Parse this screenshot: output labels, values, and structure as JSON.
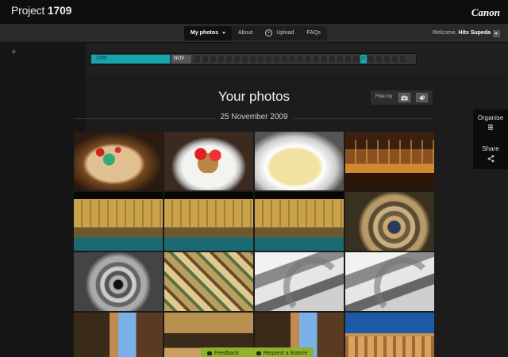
{
  "app": {
    "title_prefix": "Project",
    "title_number": "1709",
    "brand": "Canon"
  },
  "nav": {
    "items": [
      {
        "label": "My photos",
        "active": true
      },
      {
        "label": "About"
      },
      {
        "label": "Upload"
      },
      {
        "label": "FAQs"
      }
    ]
  },
  "user": {
    "welcome_prefix": "Welcome,",
    "name": "Hits Supeda"
  },
  "timeline": {
    "year": "2009",
    "month": "NOV",
    "active_day": "22"
  },
  "page": {
    "title": "Your photos",
    "filter_label": "Filter by",
    "date": "25 November 2009"
  },
  "side": {
    "organise_label": "Organise",
    "share_label": "Share"
  },
  "photos": [
    {
      "icon": "pizza-photo"
    },
    {
      "icon": "bruschetta-photo"
    },
    {
      "icon": "focaccia-photo"
    },
    {
      "icon": "bar-interior-photo"
    },
    {
      "icon": "trevi-fountain-photo"
    },
    {
      "icon": "trevi-fountain-photo"
    },
    {
      "icon": "trevi-fountain-photo"
    },
    {
      "icon": "spiral-staircase-photo"
    },
    {
      "icon": "spiral-staircase-photo"
    },
    {
      "icon": "painted-ceiling-photo"
    },
    {
      "icon": "spiral-ramp-photo"
    },
    {
      "icon": "spiral-ramp-photo"
    },
    {
      "icon": "building-photo"
    },
    {
      "icon": "ceiling-photo"
    },
    {
      "icon": "building-photo"
    },
    {
      "icon": "colosseum-photo"
    }
  ],
  "footer": {
    "feedback_label": "Feedback",
    "request_label": "Request a feature",
    "accent": "#8eb22c"
  }
}
